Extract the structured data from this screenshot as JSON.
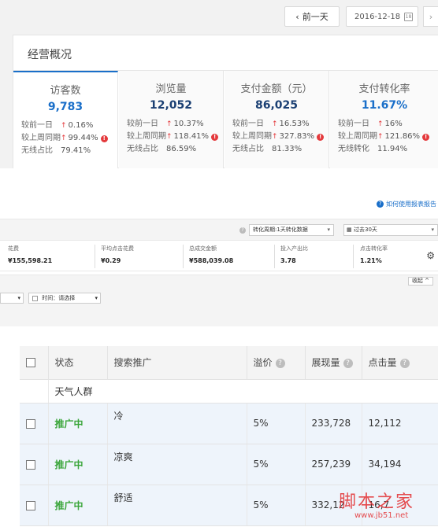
{
  "nav": {
    "prev_label": "前一天",
    "date": "2016-12-18",
    "calendar_glyph": "18"
  },
  "overview": {
    "title": "经营概况",
    "metrics": [
      {
        "name": "访客数",
        "value": "9,783",
        "rows": [
          {
            "label": "较前一日",
            "change": "0.16%",
            "warn": false
          },
          {
            "label": "较上周同期",
            "change": "99.44%",
            "warn": true
          },
          {
            "label": "无线占比",
            "change": "79.41%",
            "warn": false
          }
        ]
      },
      {
        "name": "浏览量",
        "value": "12,052",
        "rows": [
          {
            "label": "较前一日",
            "change": "10.37%",
            "warn": false
          },
          {
            "label": "较上周同期",
            "change": "118.41%",
            "warn": true
          },
          {
            "label": "无线占比",
            "change": "86.59%",
            "warn": false
          }
        ]
      },
      {
        "name": "支付金额（元）",
        "value": "86,025",
        "rows": [
          {
            "label": "较前一日",
            "change": "16.53%",
            "warn": false
          },
          {
            "label": "较上周同期",
            "change": "327.83%",
            "warn": true
          },
          {
            "label": "无线占比",
            "change": "81.33%",
            "warn": false
          }
        ]
      },
      {
        "name": "支付转化率",
        "value": "11.67%",
        "rows": [
          {
            "label": "较前一日",
            "change": "16%",
            "warn": false
          },
          {
            "label": "较上周同期",
            "change": "121.86%",
            "warn": true
          },
          {
            "label": "无线转化",
            "change": "11.94%",
            "warn": false
          }
        ]
      }
    ]
  },
  "report": {
    "help_link": "如何使用报表报告",
    "conversion_select": "转化周期:1天转化数据",
    "period_select": "过去30天",
    "summary": [
      {
        "label": "花费",
        "value": "¥155,598.21"
      },
      {
        "label": "平均点击花费",
        "value": "¥0.29"
      },
      {
        "label": "总成交金额",
        "value": "¥588,039.08"
      },
      {
        "label": "投入产出比",
        "value": "3.78"
      },
      {
        "label": "点击转化率",
        "value": "1.21%"
      }
    ],
    "fold_label": "收起",
    "time_filter": "时间：请选择"
  },
  "table": {
    "headers": {
      "status": "状态",
      "keyword": "搜索推广",
      "premium": "溢价",
      "impressions": "展现量",
      "clicks": "点击量"
    },
    "group_label": "天气人群",
    "rows": [
      {
        "status": "推广中",
        "keyword": "冷",
        "premium": "5%",
        "impressions": "233,728",
        "clicks": "12,112"
      },
      {
        "status": "推广中",
        "keyword": "凉爽",
        "premium": "5%",
        "impressions": "257,239",
        "clicks": "34,194"
      },
      {
        "status": "推广中",
        "keyword": "舒适",
        "premium": "5%",
        "impressions": "332,12",
        "clicks": "16,7"
      }
    ]
  },
  "watermark": {
    "brand": "脚本之家",
    "url": "www.jb51.net"
  },
  "colors": {
    "accent": "#1a6fc9",
    "up": "#e4393c",
    "status_green": "#3aa53a"
  }
}
